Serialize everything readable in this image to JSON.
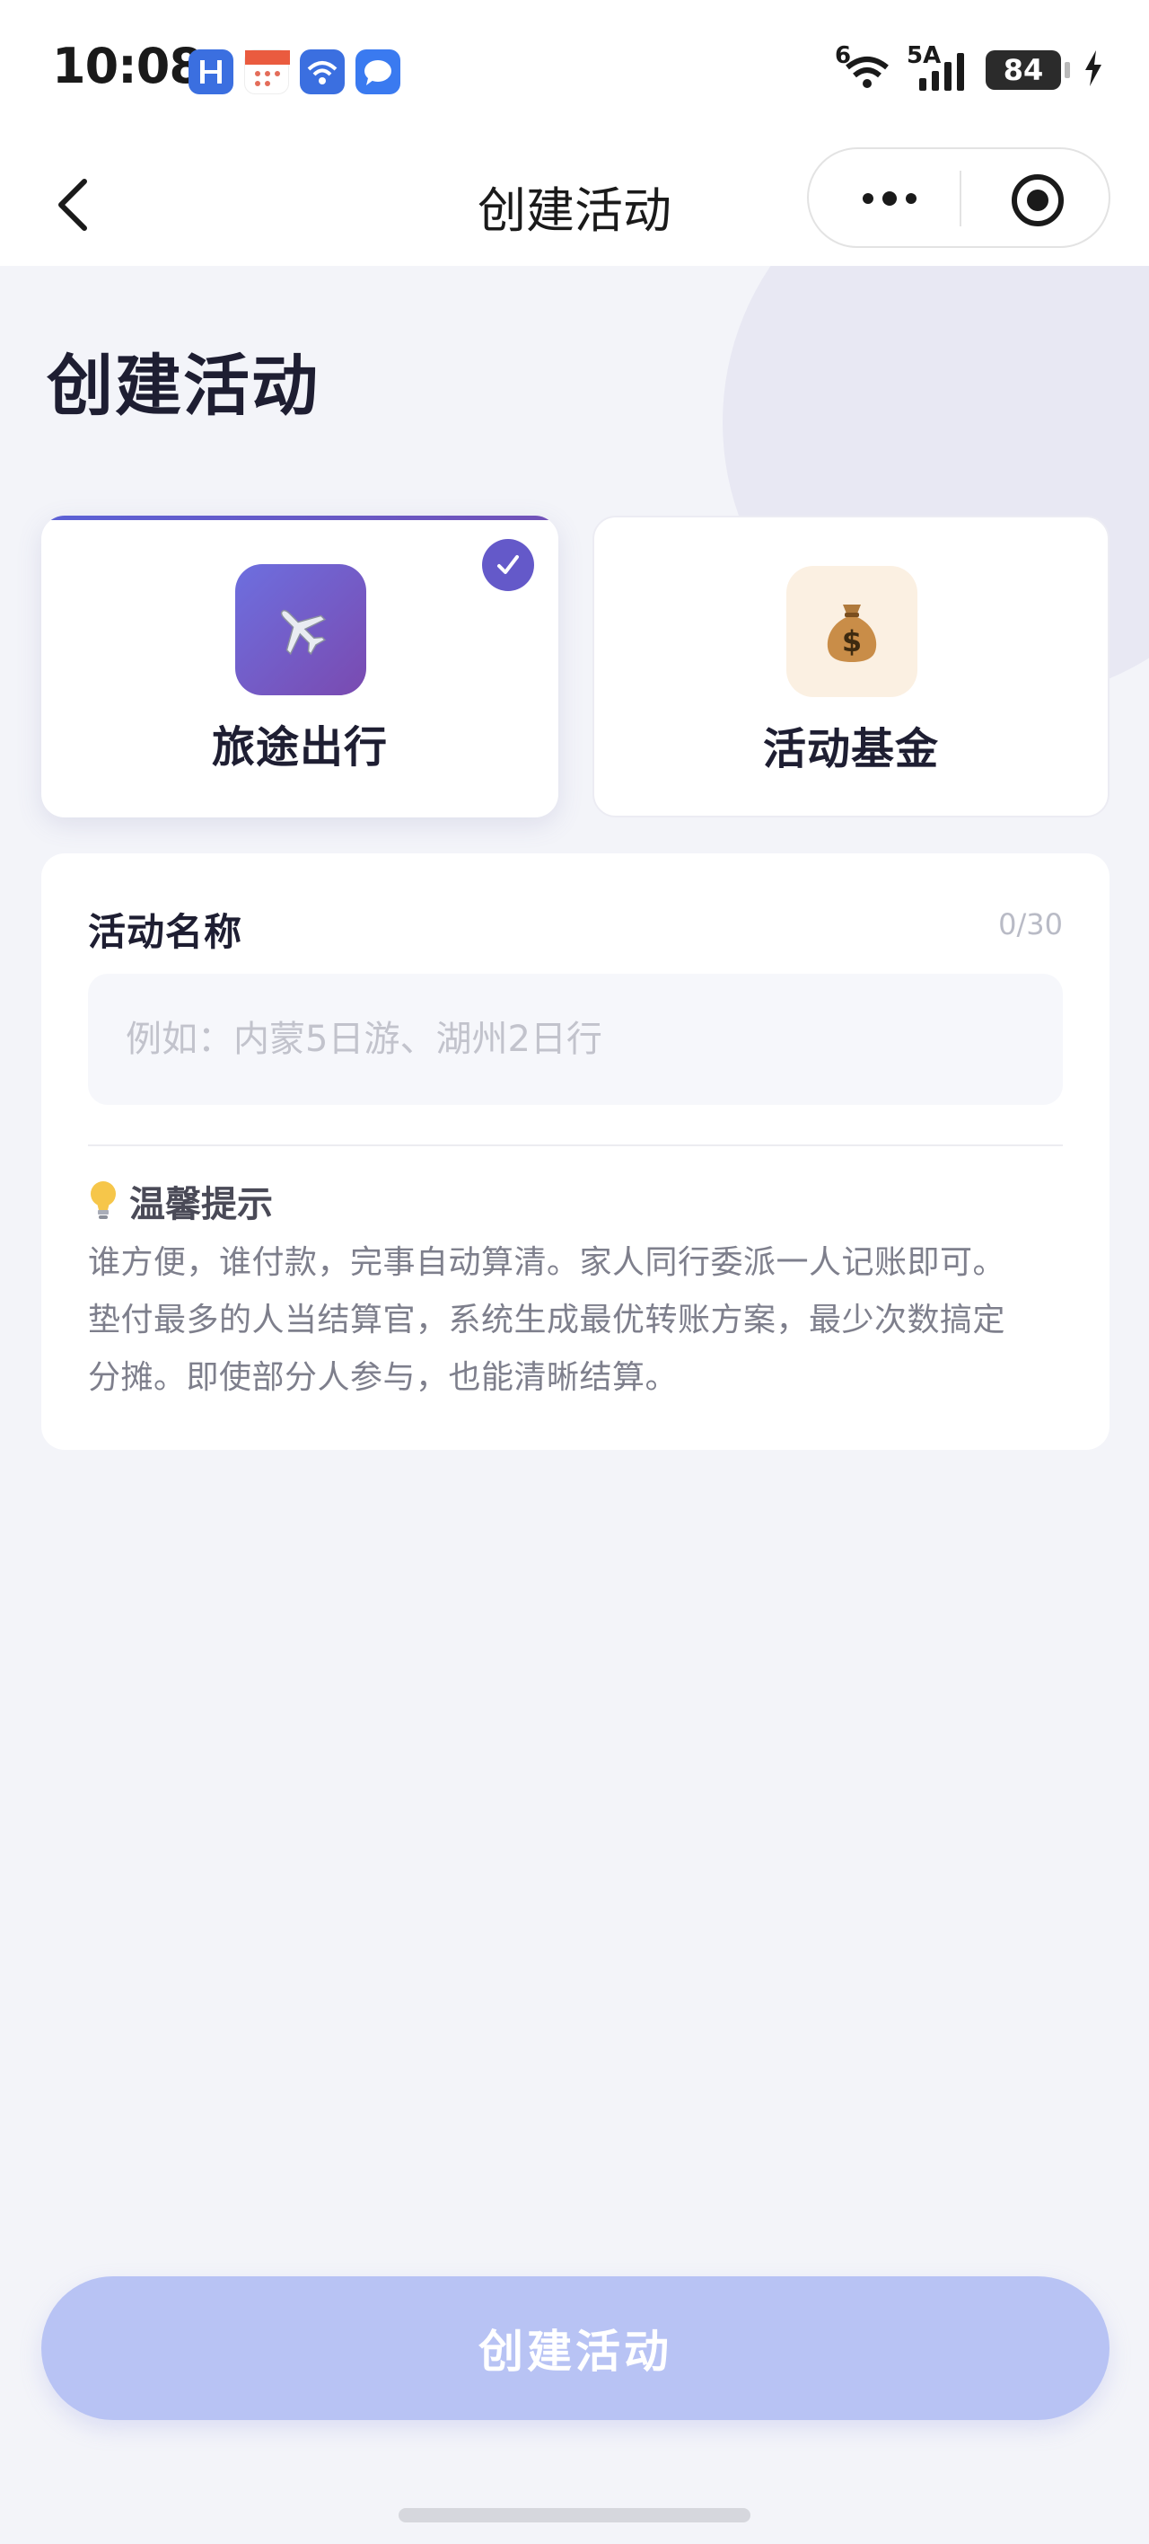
{
  "status_bar": {
    "time": "10:08",
    "wifi_label": "6",
    "network_label": "5A",
    "battery_level": "84",
    "notification_icons": [
      "harmony-app-icon",
      "calendar-app-icon",
      "wifi-app-icon",
      "message-app-icon"
    ]
  },
  "navbar": {
    "title": "创建活动",
    "back_icon": "chevron-left-icon",
    "more_icon": "more-dots-icon",
    "close_icon": "target-close-icon"
  },
  "page": {
    "heading": "创建活动"
  },
  "activity_types": [
    {
      "label": "旅途出行",
      "icon": "airplane-icon",
      "selected": true
    },
    {
      "label": "活动基金",
      "icon": "money-bag-icon",
      "selected": false
    }
  ],
  "form": {
    "name_label": "活动名称",
    "char_count": "0/30",
    "name_value": "",
    "name_placeholder": "例如：内蒙5日游、湖州2日行"
  },
  "tip": {
    "icon": "lightbulb-icon",
    "title": "温馨提示",
    "lines": [
      "谁方便，谁付款，完事自动算清。家人同行委派一人记账即可。",
      "垫付最多的人当结算官，系统生成最优转账方案，最少次数搞定",
      "分摊。即使部分人参与，也能清晰结算。"
    ]
  },
  "submit": {
    "label": "创建活动"
  },
  "colors": {
    "background": "#f3f4f9",
    "accent": "#6459c9",
    "button_disabled": "#b8c3f4"
  }
}
